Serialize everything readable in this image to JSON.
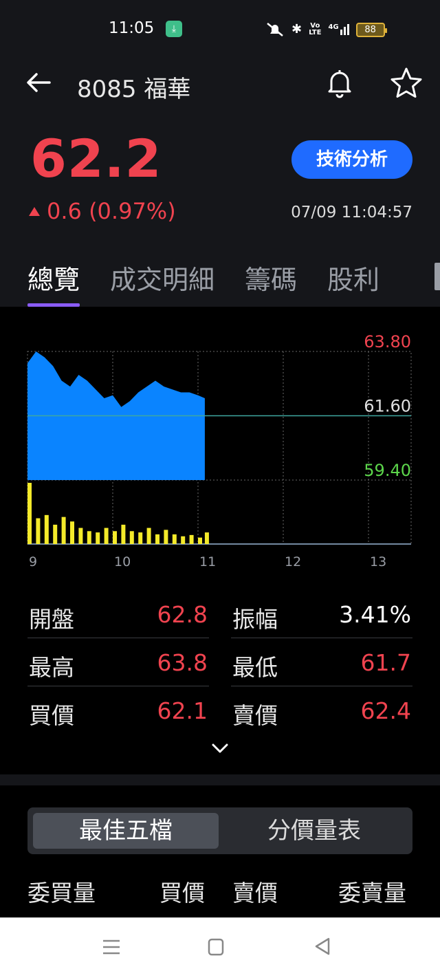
{
  "status_bar": {
    "time": "11:05",
    "download_icon": "download-icon",
    "volte_top": "Vo",
    "volte_bottom": "LTE",
    "network": "4G",
    "battery": "88"
  },
  "header": {
    "title": "8085 福華",
    "price": "62.2",
    "change": "0.6 (0.97%)",
    "technical_button": "技術分析",
    "timestamp": "07/09 11:04:57"
  },
  "tabs": [
    "總覽",
    "成交明細",
    "籌碼",
    "股利"
  ],
  "colors": {
    "up": "#f0434f",
    "down": "#5cd64b",
    "accent": "#1f6bff",
    "tab_indicator": "#8a5cf5",
    "price_area": "#0a84ff",
    "volume": "#f4ea2a"
  },
  "chart_data": {
    "type": "area",
    "y_labels": [
      "63.80",
      "61.60",
      "59.40"
    ],
    "x_labels": [
      "9",
      "10",
      "11",
      "12",
      "13"
    ],
    "ylim": [
      59.4,
      63.8
    ],
    "reference": 61.6,
    "xlim": [
      9,
      13.5
    ],
    "price_series": {
      "x": [
        9.0,
        9.1,
        9.2,
        9.3,
        9.4,
        9.5,
        9.6,
        9.7,
        9.8,
        9.9,
        10.0,
        10.1,
        10.2,
        10.3,
        10.4,
        10.5,
        10.6,
        10.7,
        10.8,
        10.9,
        11.0,
        11.08
      ],
      "y": [
        63.4,
        63.8,
        63.6,
        63.3,
        62.8,
        62.6,
        63.0,
        62.8,
        62.5,
        62.2,
        62.3,
        61.9,
        62.1,
        62.4,
        62.6,
        62.8,
        62.6,
        62.5,
        62.4,
        62.4,
        62.3,
        62.2
      ]
    },
    "volume_series": {
      "x": [
        9.0,
        9.1,
        9.2,
        9.3,
        9.4,
        9.5,
        9.6,
        9.7,
        9.8,
        9.9,
        10.0,
        10.1,
        10.2,
        10.3,
        10.4,
        10.5,
        10.6,
        10.7,
        10.8,
        10.9,
        11.0,
        11.08
      ],
      "y": [
        95,
        40,
        45,
        30,
        42,
        35,
        25,
        20,
        18,
        25,
        20,
        30,
        20,
        18,
        25,
        15,
        22,
        15,
        12,
        14,
        10,
        18
      ]
    }
  },
  "stats": {
    "open_label": "開盤",
    "open_value": "62.8",
    "amp_label": "振幅",
    "amp_value": "3.41%",
    "high_label": "最高",
    "high_value": "63.8",
    "low_label": "最低",
    "low_value": "61.7",
    "bid_label": "買價",
    "bid_value": "62.1",
    "ask_label": "賣價",
    "ask_value": "62.4"
  },
  "segment": {
    "active": "最佳五檔",
    "inactive": "分價量表"
  },
  "orderbook_headers": {
    "bid_qty": "委買量",
    "bid": "買價",
    "ask": "賣價",
    "ask_qty": "委賣量"
  }
}
